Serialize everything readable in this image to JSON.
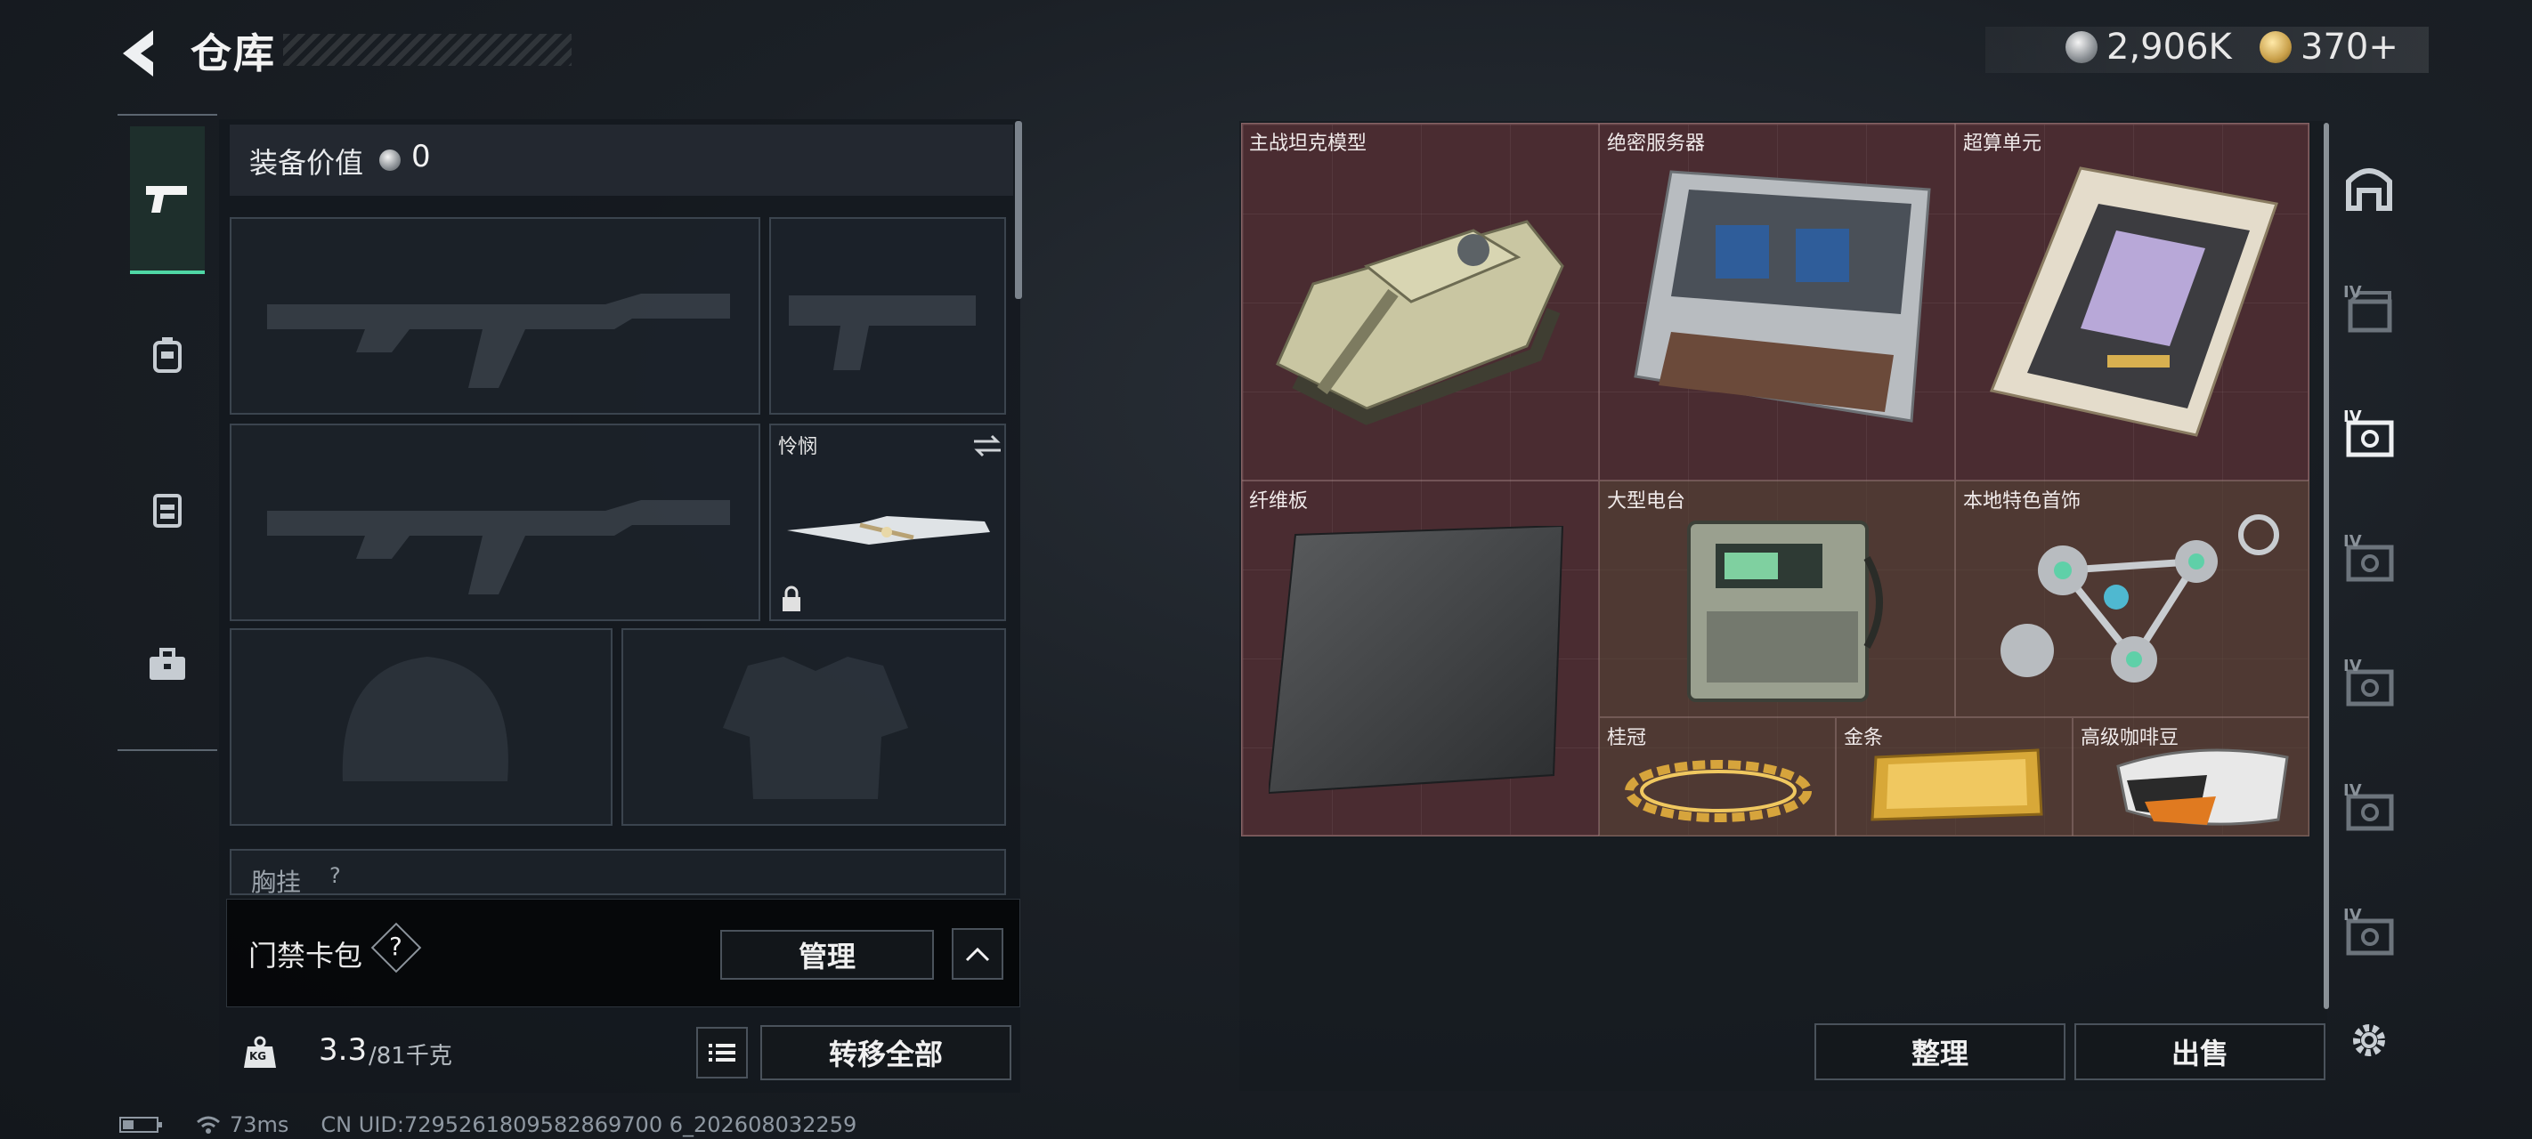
{
  "header": {
    "title": "仓库"
  },
  "currency": {
    "silver": "2,906K",
    "gold": "370+"
  },
  "equipment": {
    "value_label": "装备价值",
    "value": "0",
    "melee_name": "怜悯",
    "chest_label": "胸挂",
    "chest_value": "?"
  },
  "cardpack": {
    "label": "门禁卡包",
    "help": "?",
    "manage_label": "管理"
  },
  "weight": {
    "current": "3.3",
    "max_unit": "/81千克",
    "unit_icon": "KG",
    "transfer_label": "转移全部"
  },
  "storage": {
    "items": [
      {
        "name": "主战坦克模型"
      },
      {
        "name": "绝密服务器"
      },
      {
        "name": "超算单元"
      },
      {
        "name": "纤维板"
      },
      {
        "name": "大型电台"
      },
      {
        "name": "本地特色首饰"
      },
      {
        "name": "桂冠"
      },
      {
        "name": "金条"
      },
      {
        "name": "高级咖啡豆"
      }
    ],
    "sort_label": "整理",
    "sell_label": "出售",
    "tier_label": "IV"
  },
  "status": {
    "latency": "73ms",
    "uid": "CN UID:7295261809582869700 6_202608032259"
  },
  "colors": {
    "accent": "#4fd7a5",
    "grid_bg": "#4a2c31"
  }
}
